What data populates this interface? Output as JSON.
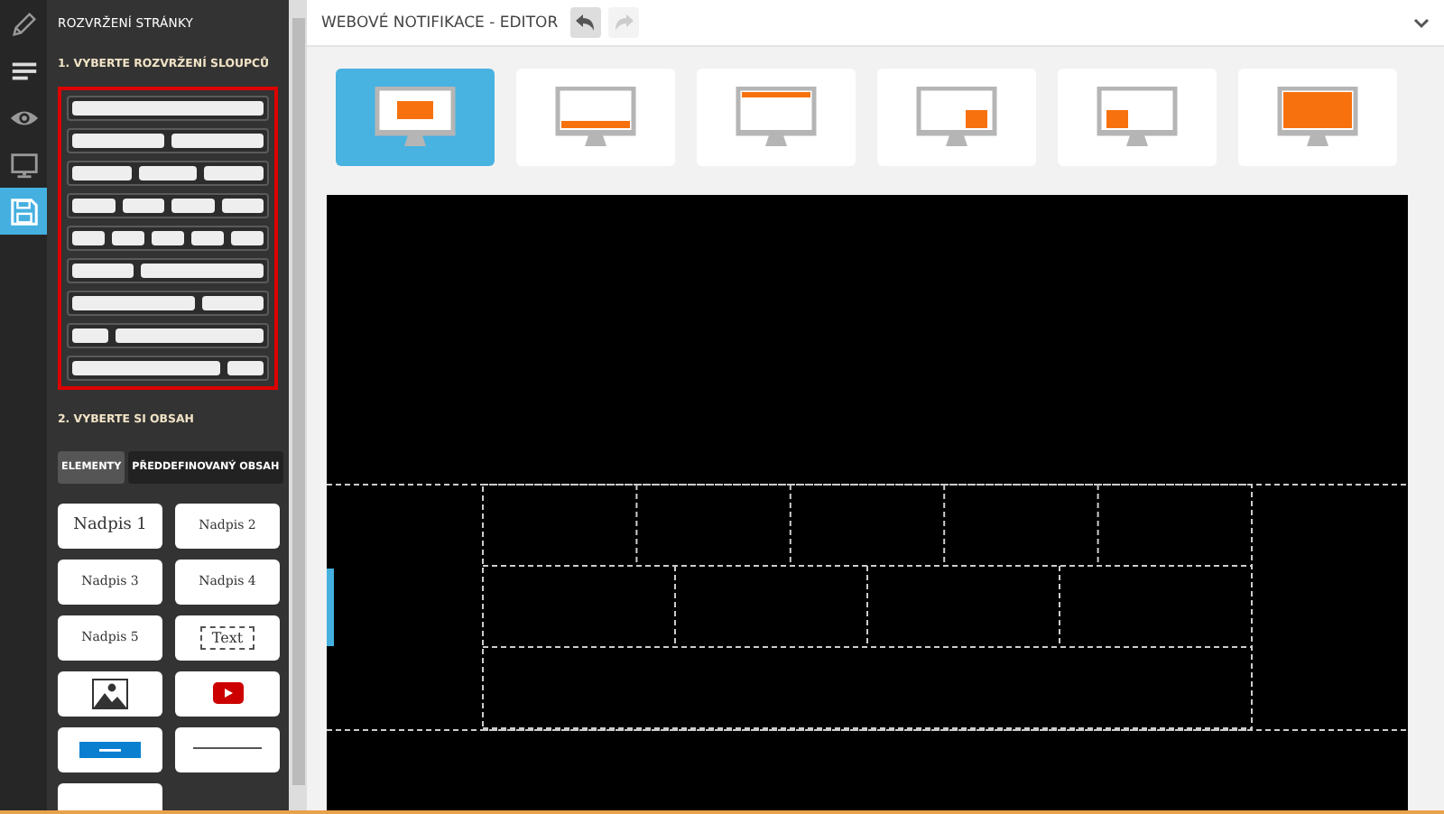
{
  "rail": [
    {
      "kind": "pencil",
      "selected": false
    },
    {
      "kind": "lines",
      "selected": false
    },
    {
      "kind": "eye",
      "selected": false
    },
    {
      "kind": "monitor",
      "selected": false
    },
    {
      "kind": "save",
      "selected": true
    }
  ],
  "sidebar": {
    "title": "ROZVRŽENÍ STRÁNKY",
    "section_1": "1. VYBERTE ROZVRŽENÍ SLOUPCŮ",
    "layouts": [
      {
        "kind": "full"
      },
      {
        "kind": "halves"
      },
      {
        "kind": "thirds"
      },
      {
        "kind": "quarters"
      },
      {
        "kind": "fifths"
      },
      {
        "kind": "narrowleft"
      },
      {
        "kind": "narrowright"
      },
      {
        "kind": "thinleft"
      },
      {
        "kind": "thinright"
      }
    ],
    "section_2": "2. VYBERTE SI OBSAH",
    "tabs": [
      {
        "label": "ELEMENTY",
        "selected": true
      },
      {
        "label": "PŘEDDEFINOVANÝ OBSAH",
        "selected": false
      }
    ],
    "elements": [
      {
        "kind": "heading1",
        "label": "Nadpis 1"
      },
      {
        "kind": "heading2",
        "label": "Nadpis 2"
      },
      {
        "kind": "heading3",
        "label": "Nadpis 3"
      },
      {
        "kind": "heading4",
        "label": "Nadpis 4"
      },
      {
        "kind": "heading5",
        "label": "Nadpis 5"
      },
      {
        "kind": "text",
        "label": "Text"
      },
      {
        "kind": "image"
      },
      {
        "kind": "video"
      },
      {
        "kind": "button"
      },
      {
        "kind": "divider"
      },
      {
        "kind": "partial"
      }
    ]
  },
  "header": {
    "title": "WEBOVÉ NOTIFIKACE - EDITOR",
    "undo": {
      "disabled": false
    },
    "redo": {
      "disabled": true
    }
  },
  "positions": [
    {
      "kind": "center",
      "selected": true
    },
    {
      "kind": "bottom",
      "selected": false
    },
    {
      "kind": "top",
      "selected": false
    },
    {
      "kind": "corner-right",
      "selected": false
    },
    {
      "kind": "corner-left",
      "selected": false
    },
    {
      "kind": "fullscreen",
      "selected": false
    }
  ]
}
